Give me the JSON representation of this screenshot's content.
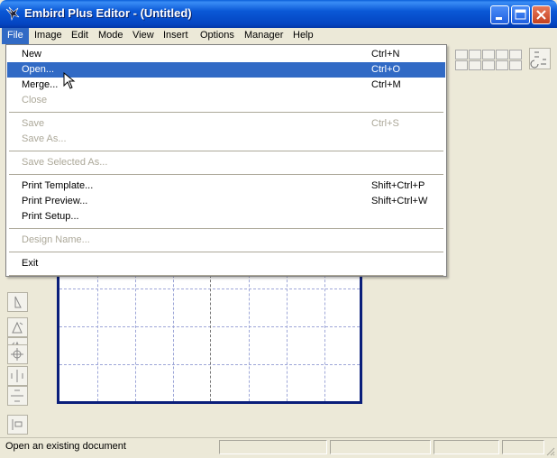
{
  "window": {
    "title": "Embird Plus Editor - (Untitled)",
    "icon": "embird-bird-icon",
    "title_color": "#0a58d6"
  },
  "menubar": {
    "items": [
      {
        "label": "File",
        "active": true
      },
      {
        "label": "Image"
      },
      {
        "label": "Edit"
      },
      {
        "label": "Mode"
      },
      {
        "label": "View"
      },
      {
        "label": "Insert"
      },
      {
        "label": "Options"
      },
      {
        "label": "Manager"
      },
      {
        "label": "Help"
      }
    ]
  },
  "file_menu": {
    "highlight_color": "#316ac5",
    "groups": [
      [
        {
          "label": "New",
          "shortcut": "Ctrl+N"
        },
        {
          "label": "Open...",
          "shortcut": "Ctrl+O",
          "highlighted": true
        },
        {
          "label": "Merge...",
          "shortcut": "Ctrl+M"
        },
        {
          "label": "Close",
          "shortcut": "",
          "disabled": true
        }
      ],
      [
        {
          "label": "Save",
          "shortcut": "Ctrl+S",
          "disabled": true
        },
        {
          "label": "Save As...",
          "shortcut": "",
          "disabled": true
        }
      ],
      [
        {
          "label": "Save Selected As...",
          "shortcut": "",
          "disabled": true
        }
      ],
      [
        {
          "label": "Print Template...",
          "shortcut": "Shift+Ctrl+P"
        },
        {
          "label": "Print Preview...",
          "shortcut": "Shift+Ctrl+W"
        },
        {
          "label": "Print Setup...",
          "shortcut": ""
        }
      ],
      [
        {
          "label": "Design Name...",
          "shortcut": "",
          "disabled": true
        }
      ],
      [
        {
          "label": "Exit",
          "shortcut": ""
        }
      ]
    ]
  },
  "statusbar": {
    "text": "Open an existing document"
  },
  "left_tools": [
    "mirror-icon",
    "rotate-left-icon",
    "rotate-right-icon",
    "center-icon",
    "align-horizontal-icon",
    "align-vertical-icon",
    "distribute-icon"
  ]
}
